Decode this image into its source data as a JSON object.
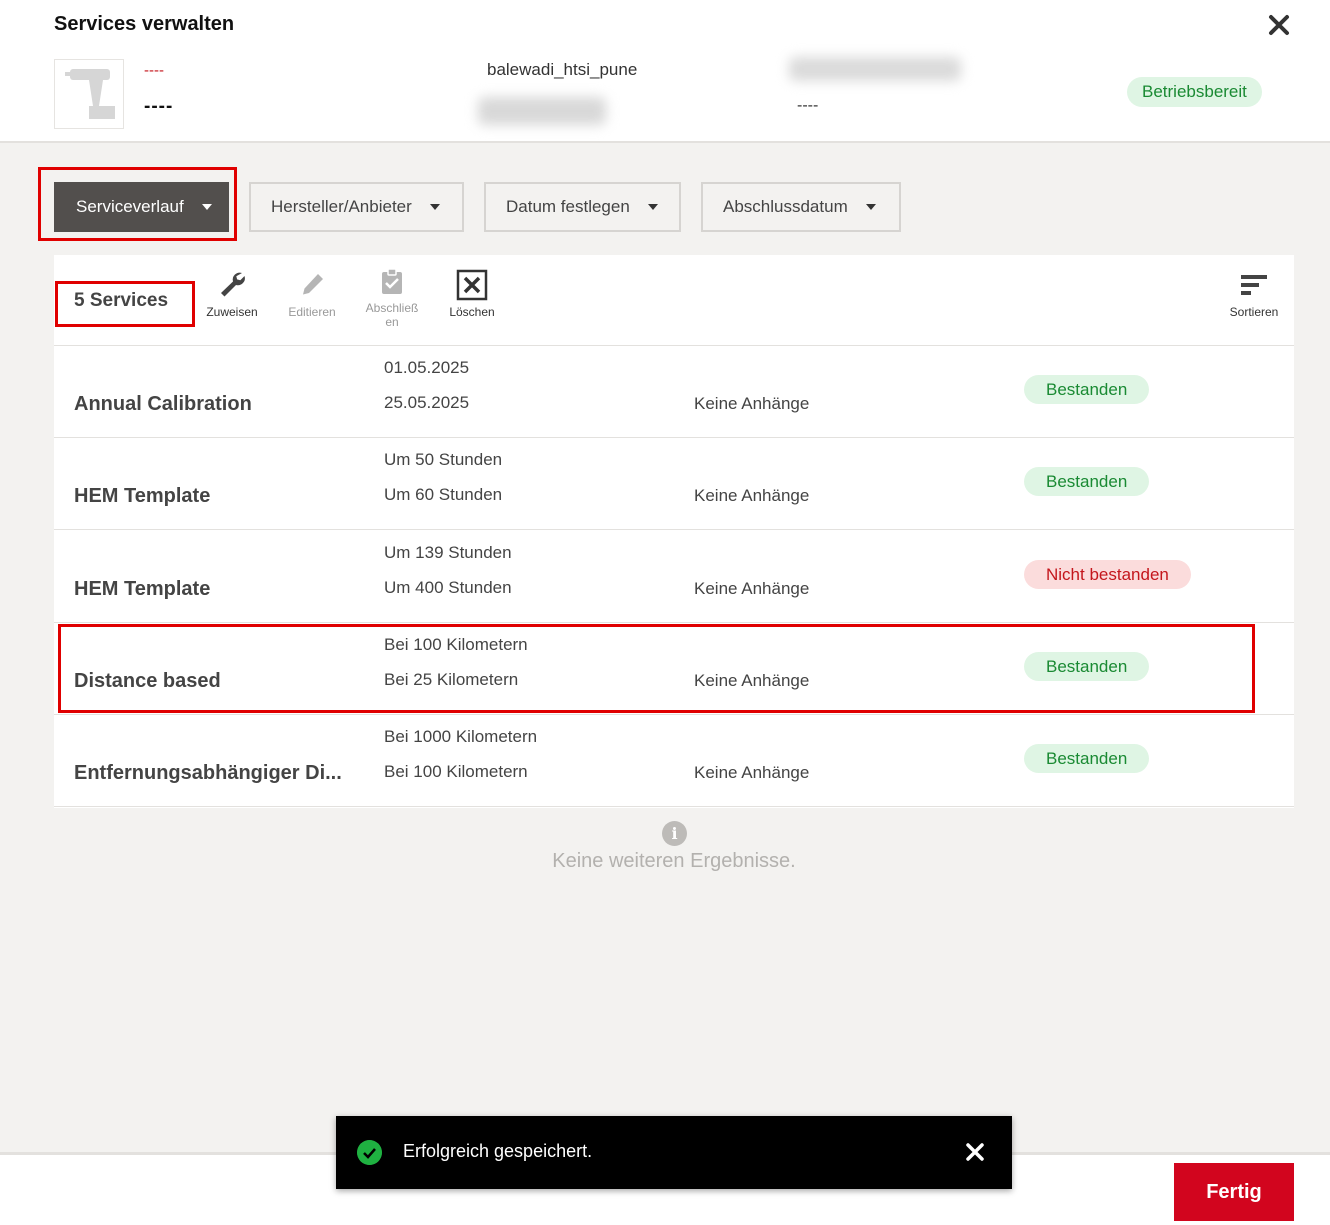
{
  "dialog": {
    "title": "Services verwalten"
  },
  "asset": {
    "red_label": "----",
    "name": "----",
    "location": "balewadi_htsi_pune",
    "field2": "----",
    "status": "Betriebsbereit"
  },
  "filters": [
    {
      "label": "Serviceverlauf"
    },
    {
      "label": "Hersteller/Anbieter"
    },
    {
      "label": "Datum festlegen"
    },
    {
      "label": "Abschlussdatum"
    }
  ],
  "toolbar": {
    "count": "5 Services",
    "assign": "Zuweisen",
    "edit": "Editieren",
    "complete_l1": "Abschließ",
    "complete_l2": "en",
    "delete": "Löschen",
    "sort": "Sortieren"
  },
  "services": [
    {
      "name": "Annual Calibration",
      "line1": "01.05.2025",
      "line2": "25.05.2025",
      "attachments": "Keine Anhänge",
      "status": "Bestanden"
    },
    {
      "name": "HEM Template",
      "line1": "Um 50 Stunden",
      "line2": "Um 60 Stunden",
      "attachments": "Keine Anhänge",
      "status": "Bestanden"
    },
    {
      "name": "HEM Template",
      "line1": "Um 139 Stunden",
      "line2": "Um 400 Stunden",
      "attachments": "Keine Anhänge",
      "status": "Nicht bestanden"
    },
    {
      "name": "Distance based",
      "line1": "Bei 100 Kilometern",
      "line2": "Bei 25 Kilometern",
      "attachments": "Keine Anhänge",
      "status": "Bestanden"
    },
    {
      "name": "Entfernungsabhängiger Di...",
      "line1": "Bei 1000 Kilometern",
      "line2": "Bei 100 Kilometern",
      "attachments": "Keine Anhänge",
      "status": "Bestanden"
    }
  ],
  "no_more_results": "Keine weiteren Ergebnisse.",
  "toast": {
    "message": "Erfolgreich gespeichert."
  },
  "footer": {
    "done_label": "Fertig"
  },
  "colors": {
    "accent_red": "#d2051e",
    "pass_text": "#1a8a33",
    "pass_bg": "#dff5e4",
    "fail_text": "#c4161c",
    "fail_bg": "#fbdcdc"
  }
}
